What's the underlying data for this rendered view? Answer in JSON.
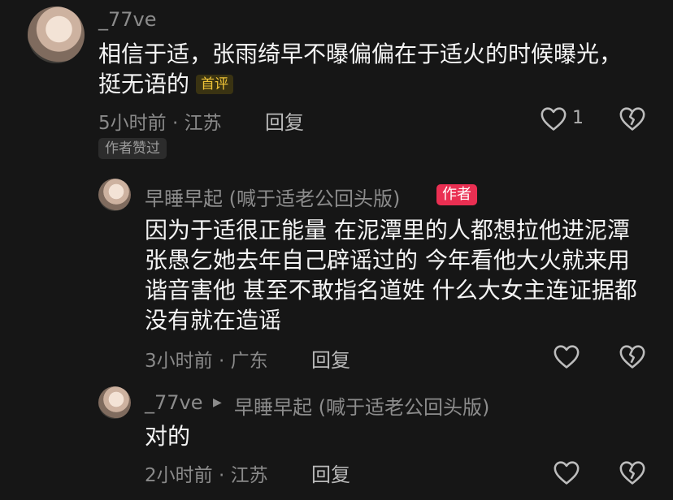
{
  "comments": [
    {
      "username": "_77ve",
      "text": "相信于适，张雨绮早不曝偏偏在于适火的时候曝光，挺无语的",
      "badge": "首评",
      "meta": "5小时前 · 江苏",
      "reply_label": "回复",
      "like_count": "1",
      "chip": "作者赞过"
    },
    {
      "username": "早睡早起 (喊于适老公回头版)",
      "badge": "作者",
      "text": "因为于适很正能量 在泥潭里的人都想拉他进泥潭 张愚乞她去年自己辟谣过的 今年看他大火就来用谐音害他 甚至不敢指名道姓 什么大女主连证据都没有就在造谣",
      "meta": "3小时前 · 广东",
      "reply_label": "回复"
    },
    {
      "username": "_77ve",
      "reply_to": "早睡早起 (喊于适老公回头版)",
      "text": "对的",
      "meta": "2小时前 · 江苏",
      "reply_label": "回复"
    }
  ],
  "icons": {
    "like": "heart-outline-icon",
    "dislike": "broken-heart-icon",
    "reply_arrow": "triangle-right-icon"
  },
  "colors": {
    "background": "#161616",
    "author_badge": "#ea2f52",
    "first_badge_text": "#f0c437"
  }
}
